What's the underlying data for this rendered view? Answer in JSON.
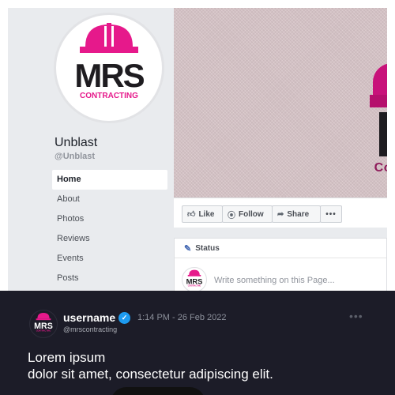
{
  "page": {
    "name": "Unblast",
    "handle": "@Unblast"
  },
  "logo": {
    "brand": "MRS",
    "sub": "CONTRACTING",
    "hat_color": "#e6198b",
    "text_color": "#1e1c20"
  },
  "nav": [
    {
      "label": "Home",
      "active": true
    },
    {
      "label": "About",
      "active": false
    },
    {
      "label": "Photos",
      "active": false
    },
    {
      "label": "Reviews",
      "active": false
    },
    {
      "label": "Events",
      "active": false
    },
    {
      "label": "Posts",
      "active": false
    }
  ],
  "cover": {
    "partial_text": "Co"
  },
  "actions": {
    "like": "Like",
    "follow": "Follow",
    "share": "Share",
    "more": "•••",
    "like_icon": "thumbs-up-icon",
    "follow_icon": "wifi-icon",
    "share_icon": "share-arrow-icon"
  },
  "status": {
    "title": "Status",
    "placeholder": "Write something on this Page..."
  },
  "tweet": {
    "username": "username",
    "handle": "@mrscontracting",
    "time": "1:14 PM - 26 Feb 2022",
    "line1": "Lorem ipsum",
    "line2": "dolor sit amet, consectetur adipiscing elit.",
    "more": "•••",
    "verified_color": "#1d9bf0",
    "background": "#1c1c28"
  }
}
